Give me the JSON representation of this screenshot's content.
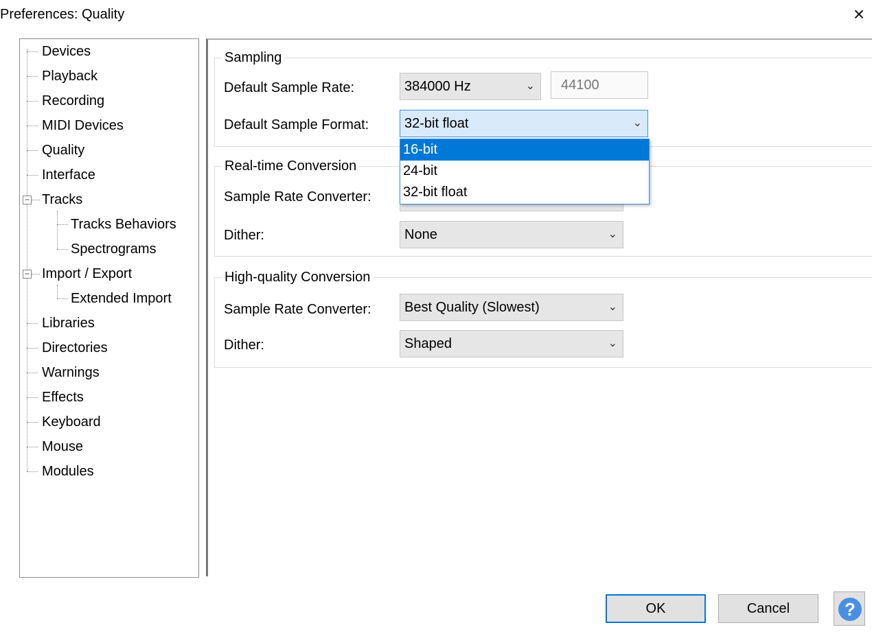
{
  "window": {
    "title": "Preferences: Quality",
    "close_glyph": "×"
  },
  "tree": {
    "items": [
      {
        "label": "Devices"
      },
      {
        "label": "Playback"
      },
      {
        "label": "Recording"
      },
      {
        "label": "MIDI Devices"
      },
      {
        "label": "Quality",
        "selected": true
      },
      {
        "label": "Interface"
      },
      {
        "label": "Tracks",
        "expanded": true
      },
      {
        "label": "Tracks Behaviors"
      },
      {
        "label": "Spectrograms"
      },
      {
        "label": "Import / Export",
        "expanded": true
      },
      {
        "label": "Extended Import"
      },
      {
        "label": "Libraries"
      },
      {
        "label": "Directories"
      },
      {
        "label": "Warnings"
      },
      {
        "label": "Effects"
      },
      {
        "label": "Keyboard"
      },
      {
        "label": "Mouse"
      },
      {
        "label": "Modules"
      }
    ],
    "expander_glyph": "−"
  },
  "sampling": {
    "title": "Sampling",
    "rate_label": "Default Sample Rate:",
    "rate_value": "384000 Hz",
    "rate_custom": "44100",
    "format_label": "Default Sample Format:",
    "format_value": "32-bit float",
    "format_options": [
      "16-bit",
      "24-bit",
      "32-bit float"
    ]
  },
  "realtime": {
    "title": "Real-time Conversion",
    "src_label": "Sample Rate Converter:",
    "dither_label": "Dither:",
    "dither_value": "None"
  },
  "highquality": {
    "title": "High-quality Conversion",
    "src_label": "Sample Rate Converter:",
    "src_value": "Best Quality (Slowest)",
    "dither_label": "Dither:",
    "dither_value": "Shaped"
  },
  "buttons": {
    "ok": "OK",
    "cancel": "Cancel",
    "help": "?"
  },
  "icons": {
    "chevron": "chevron-down-icon",
    "help": "help-icon",
    "close": "close-icon"
  },
  "colors": {
    "accent": "#0078d7",
    "selection": "#0078d7",
    "help_blue": "#4a90e2"
  }
}
